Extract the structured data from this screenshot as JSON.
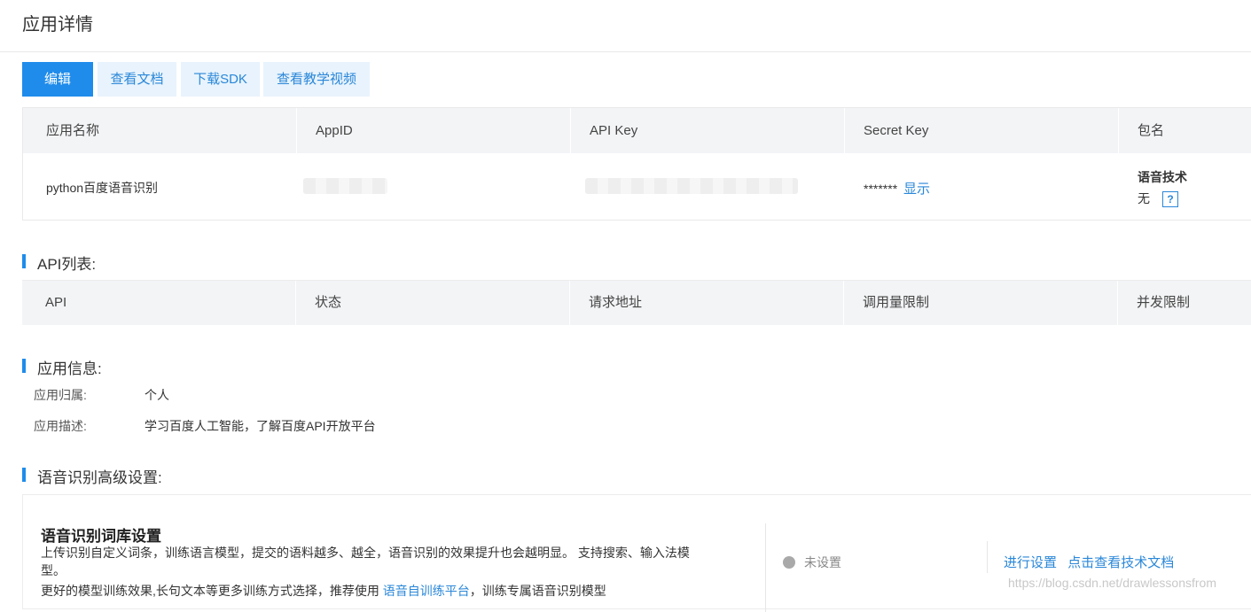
{
  "page": {
    "title": "应用详情"
  },
  "toolbar": {
    "edit": "编辑",
    "docs": "查看文档",
    "sdk": "下载SDK",
    "video": "查看教学视频"
  },
  "app_table": {
    "headers": [
      "应用名称",
      "AppID",
      "API Key",
      "Secret Key",
      "包名"
    ],
    "row": {
      "name": "python百度语音识别",
      "secret_mask": "*******",
      "secret_show": "显示",
      "package_title": "语音技术",
      "package_value": "无",
      "help": "?"
    }
  },
  "api_list": {
    "title": "API列表:",
    "headers": [
      "API",
      "状态",
      "请求地址",
      "调用量限制",
      "并发限制"
    ]
  },
  "app_info": {
    "title": "应用信息:",
    "owner_label": "应用归属:",
    "owner_value": "个人",
    "desc_label": "应用描述:",
    "desc_value": "学习百度人工智能，了解百度API开放平台"
  },
  "advanced": {
    "title": "语音识别高级设置:",
    "card_title": "语音识别词库设置",
    "desc_line1": "上传识别自定义词条，训练语言模型，提交的语料越多、越全，语音识别的效果提升也会越明显。 支持搜索、输入法模",
    "desc_line2": "型。",
    "desc_line3_pre": "更好的模型训练效果,长句文本等更多训练方式选择，推荐使用 ",
    "desc_line3_link": "语音自训练平台",
    "desc_line3_post": "，训练专属语音识别模型",
    "status": "未设置",
    "action_setup": "进行设置",
    "action_docs": "点击查看技术文档"
  },
  "watermark": "https://blog.csdn.net/drawlessonsfrom"
}
